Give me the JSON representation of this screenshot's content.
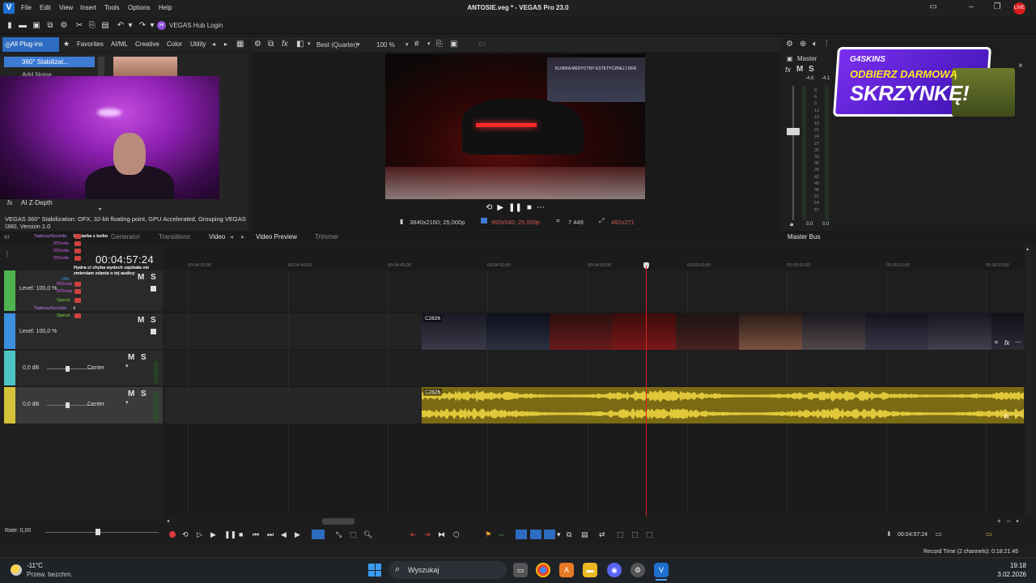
{
  "titlebar": {
    "app_logo": "V",
    "menu": [
      "File",
      "Edit",
      "View",
      "Insert",
      "Tools",
      "Options",
      "Help"
    ],
    "title": "ANTOSIE.veg * - VEGAS Pro 23.0"
  },
  "toolbar": {
    "hub_login": "VEGAS Hub Login"
  },
  "plugins": {
    "tabs": [
      "All Plug-ins",
      "Favorites",
      "AI/ML",
      "Creative",
      "Color",
      "Utility"
    ],
    "selected": "360° Stabilizat...",
    "second_item": "Add Noise",
    "bottom_item": "AI Z-Depth",
    "description": "VEGAS 360° Stabilization: OFX, 32-bit floating point, GPU Accelerated, Grouping VEGAS \\360, Version 1.0"
  },
  "preview": {
    "quality": "Best (Quarter)",
    "zoom": "100 %",
    "shop_sign": "KLINIKA MEDYCYNY ESTETYCZNEJ | DER",
    "project_res": "3840x2160; 25,000p",
    "preview_res": "960x540; 25,000p",
    "frame": "7 449",
    "display_size": "482x271"
  },
  "master": {
    "label": "Master",
    "peak_l": "-4.6",
    "peak_r": "-4.1",
    "scale": [
      "3",
      "6",
      "9",
      "12",
      "15",
      "18",
      "21",
      "24",
      "27",
      "30",
      "33",
      "36",
      "39",
      "42",
      "45",
      "48",
      "51",
      "54",
      "57"
    ],
    "bottom_l": "0.0",
    "bottom_r": "0.0"
  },
  "ad": {
    "brand": "G4SKINS",
    "line1": "ODBIERZ DARMOWĄ",
    "line2": "SKRZYNKĘ!"
  },
  "bottom_tabs": {
    "generator": "Generator",
    "transitions": "Transitions",
    "video": "Video",
    "video_preview": "Video Preview",
    "trimmer": "Trimmer",
    "master_bus": "Master Bus"
  },
  "timeline": {
    "timecode": "00:04:57:24",
    "ticks": [
      "00:04:35;00",
      "00:04:40;00",
      "00:04:45;00",
      "00:04:50;00",
      "00:04:55;00",
      "00:05:00;00",
      "00:05:05;00",
      "00:05:10;00",
      "00:05:15;00"
    ],
    "tracks": [
      {
        "level": "Level: 100,0 %",
        "m": "M",
        "s": "S",
        "color": "#4fb34f"
      },
      {
        "level": "Level: 100,0 %",
        "m": "M",
        "s": "S",
        "color": "#3d8fe0"
      },
      {
        "db": "0,0 dB",
        "pan": "Center",
        "m": "M",
        "s": "S",
        "color": "#4fc4c4"
      },
      {
        "db": "0,0 dB",
        "pan": "Center",
        "m": "M",
        "s": "S",
        "color": "#d4c23a"
      }
    ],
    "video_clip": "C2826",
    "audio_clip": "C2826"
  },
  "chat": [
    {
      "user": "TadeuszSzczota",
      "msg": "kosiarka z turbo",
      "color": "#c77dff"
    },
    {
      "user": "00Soda",
      "msg": "",
      "color": "#d05ce6"
    },
    {
      "user": "00Soda",
      "msg": "",
      "color": "#d05ce6"
    },
    {
      "user": "00Soda",
      "msg": "",
      "color": "#d05ce6"
    },
    {
      "user": "",
      "msg": "Hydra ci chyba wydech zajebała nie zmieniam zdania o tej audicy",
      "color": "#fff"
    },
    {
      "user": "Otis",
      "msg": "",
      "color": "#4a9cff"
    },
    {
      "user": "00Soda",
      "msg": "",
      "color": "#d05ce6"
    },
    {
      "user": "00Soda",
      "msg": "",
      "color": "#d05ce6"
    },
    {
      "user": "Speczi",
      "msg": "",
      "color": "#7cdc3c"
    },
    {
      "user": "TadeuszSzczota",
      "msg": "t",
      "color": "#c77dff"
    },
    {
      "user": "Speczi",
      "msg": "",
      "color": "#7cdc3c"
    }
  ],
  "bottom": {
    "rate": "Rate: 0,00",
    "timecode": "00:04:57:24",
    "record_time": "Record Time (2 channels): 0:18:21:45"
  },
  "taskbar": {
    "temp": "-11°C",
    "weather": "Przew. bezchm.",
    "search": "Wyszukaj",
    "time": "19:18",
    "date": "3.02.2026"
  }
}
